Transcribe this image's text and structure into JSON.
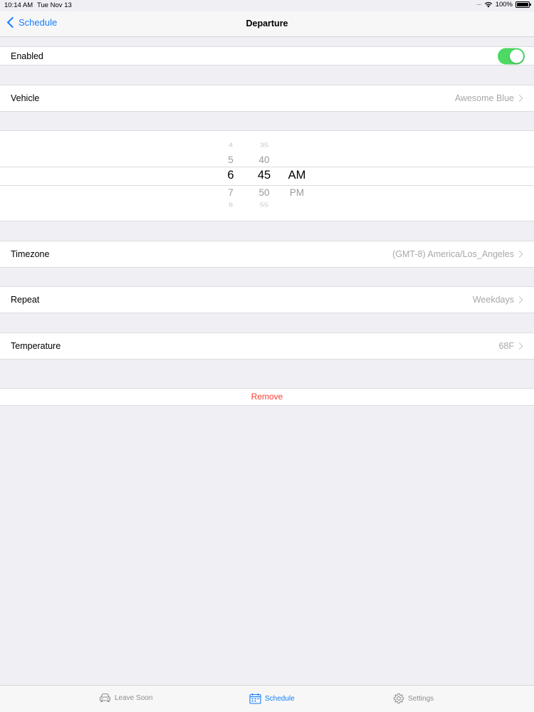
{
  "status_bar": {
    "time": "10:14 AM",
    "date": "Tue Nov 13",
    "battery": "100%"
  },
  "nav": {
    "back_label": "Schedule",
    "title": "Departure"
  },
  "enabled_row": {
    "label": "Enabled",
    "toggle_on": true
  },
  "vehicle_row": {
    "label": "Vehicle",
    "value": "Awesome Blue"
  },
  "time_picker": {
    "hours": [
      "4",
      "5",
      "6",
      "7",
      "8"
    ],
    "minutes": [
      "35",
      "40",
      "45",
      "50",
      "55"
    ],
    "ampm": [
      "AM",
      "PM"
    ],
    "selected_hour": "6",
    "selected_minute": "45",
    "selected_ampm": "AM"
  },
  "timezone_row": {
    "label": "Timezone",
    "value": "(GMT-8) America/Los_Angeles"
  },
  "repeat_row": {
    "label": "Repeat",
    "value": "Weekdays"
  },
  "temperature_row": {
    "label": "Temperature",
    "value": "68F"
  },
  "remove_button": {
    "label": "Remove"
  },
  "tab_bar": {
    "tabs": [
      {
        "label": "Leave Soon",
        "icon": "car-icon",
        "active": false
      },
      {
        "label": "Schedule",
        "icon": "calendar-icon",
        "active": true
      },
      {
        "label": "Settings",
        "icon": "gear-icon",
        "active": false
      }
    ]
  },
  "colors": {
    "accent": "#147efb",
    "toggle_on": "#4cd964",
    "destructive": "#ff3b30",
    "background": "#efeff4"
  }
}
